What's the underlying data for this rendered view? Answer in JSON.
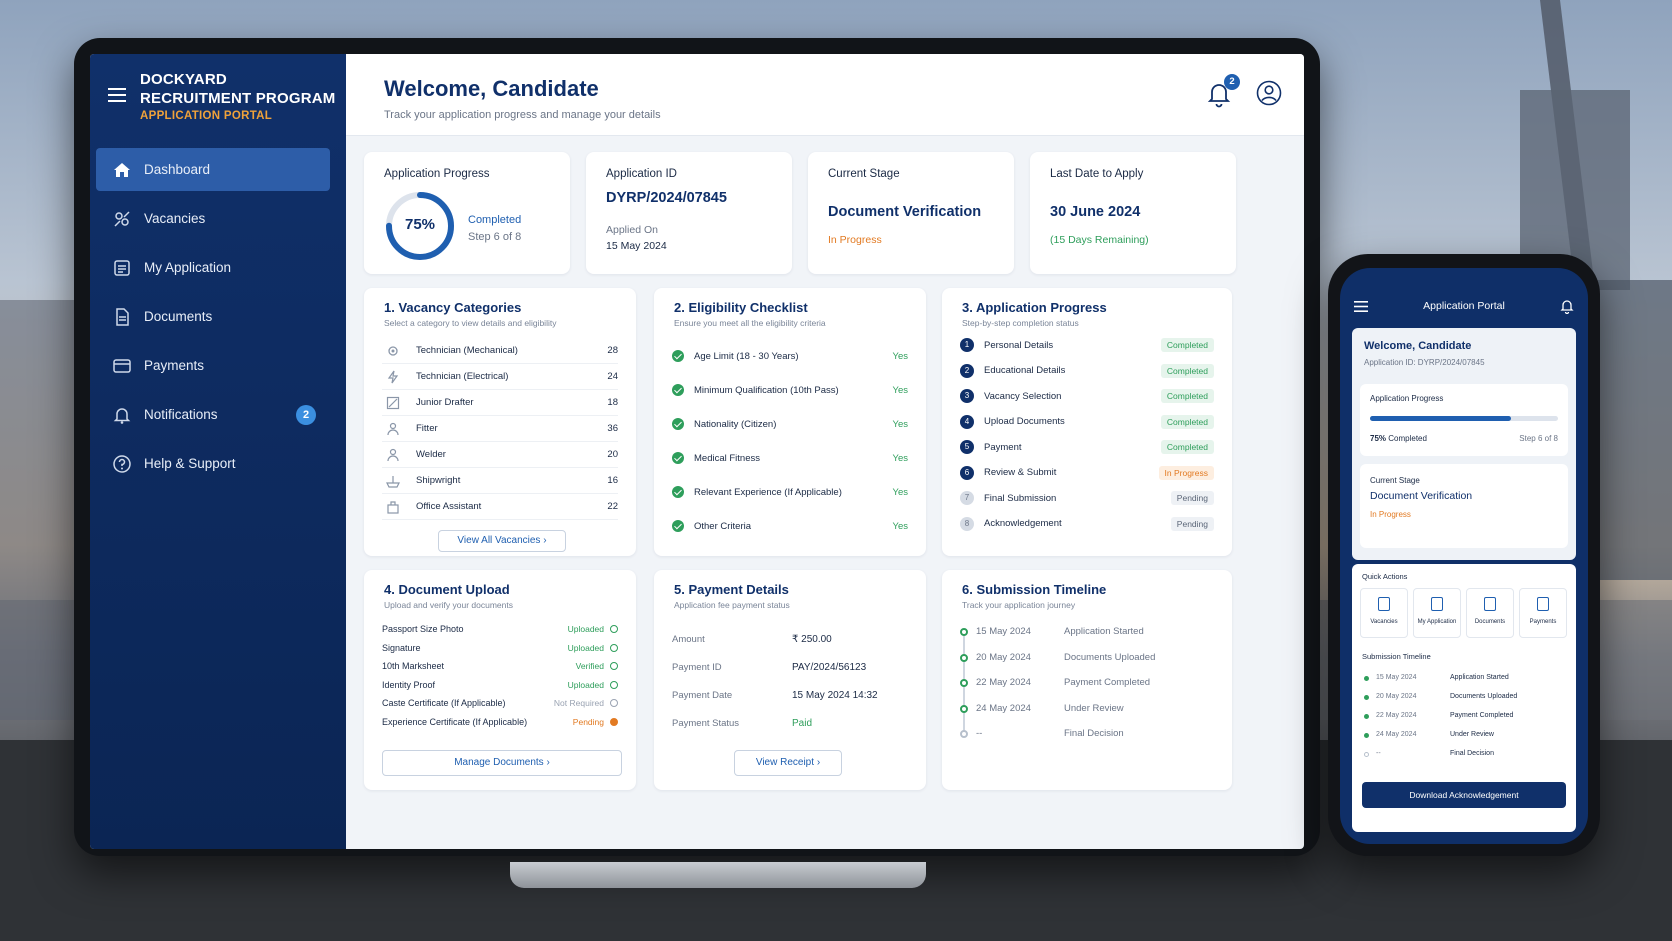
{
  "brand": {
    "line1": "DOCKYARD",
    "line2": "RECRUITMENT PROGRAM",
    "line3": "APPLICATION PORTAL"
  },
  "sidebar": {
    "items": [
      {
        "label": "Dashboard",
        "icon": "home-icon"
      },
      {
        "label": "Vacancies",
        "icon": "vacancies-icon"
      },
      {
        "label": "My Application",
        "icon": "application-icon"
      },
      {
        "label": "Documents",
        "icon": "documents-icon"
      },
      {
        "label": "Payments",
        "icon": "payments-icon"
      },
      {
        "label": "Notifications",
        "icon": "bell-icon",
        "badge": "2"
      },
      {
        "label": "Help & Support",
        "icon": "help-icon"
      }
    ]
  },
  "header": {
    "title": "Welcome, Candidate",
    "subtitle": "Track your application progress and manage your details",
    "notif_count": "2"
  },
  "stats": {
    "progress": {
      "label": "Application Progress",
      "percent_text": "75%",
      "percent": 0.75,
      "status": "Completed",
      "step": "Step 6 of 8"
    },
    "app_id": {
      "label": "Application ID",
      "value": "DYRP/2024/07845",
      "applied_label": "Applied On",
      "applied_date": "15 May 2024"
    },
    "stage": {
      "label": "Current Stage",
      "value": "Document Verification",
      "status": "In Progress"
    },
    "deadline": {
      "label": "Last Date to Apply",
      "value": "30 June 2024",
      "remaining": "(15 Days Remaining)"
    }
  },
  "vacancies": {
    "title": "1. Vacancy Categories",
    "subtitle": "Select a category to view details and eligibility",
    "button": "View All Vacancies",
    "items": [
      {
        "name": "Technician (Mechanical)",
        "count": "28"
      },
      {
        "name": "Technician (Electrical)",
        "count": "24"
      },
      {
        "name": "Junior Drafter",
        "count": "18"
      },
      {
        "name": "Fitter",
        "count": "36"
      },
      {
        "name": "Welder",
        "count": "20"
      },
      {
        "name": "Shipwright",
        "count": "16"
      },
      {
        "name": "Office Assistant",
        "count": "22"
      }
    ]
  },
  "eligibility": {
    "title": "2. Eligibility Checklist",
    "subtitle": "Ensure you meet all the eligibility criteria",
    "items": [
      {
        "name": "Age Limit (18 - 30 Years)",
        "value": "Yes"
      },
      {
        "name": "Minimum Qualification (10th Pass)",
        "value": "Yes"
      },
      {
        "name": "Nationality (Citizen)",
        "value": "Yes"
      },
      {
        "name": "Medical Fitness",
        "value": "Yes"
      },
      {
        "name": "Relevant Experience (If Applicable)",
        "value": "Yes"
      },
      {
        "name": "Other Criteria",
        "value": "Yes"
      }
    ]
  },
  "steps": {
    "title": "3. Application Progress",
    "subtitle": "Step-by-step completion status",
    "items": [
      {
        "num": "1",
        "name": "Personal Details",
        "status": "Completed",
        "kind": "done"
      },
      {
        "num": "2",
        "name": "Educational Details",
        "status": "Completed",
        "kind": "done"
      },
      {
        "num": "3",
        "name": "Vacancy Selection",
        "status": "Completed",
        "kind": "done"
      },
      {
        "num": "4",
        "name": "Upload Documents",
        "status": "Completed",
        "kind": "done"
      },
      {
        "num": "5",
        "name": "Payment",
        "status": "Completed",
        "kind": "done"
      },
      {
        "num": "6",
        "name": "Review & Submit",
        "status": "In Progress",
        "kind": "prog"
      },
      {
        "num": "7",
        "name": "Final Submission",
        "status": "Pending",
        "kind": "pend"
      },
      {
        "num": "8",
        "name": "Acknowledgement",
        "status": "Pending",
        "kind": "pend"
      }
    ]
  },
  "documents": {
    "title": "4. Document Upload",
    "subtitle": "Upload and verify your documents",
    "button": "Manage Documents",
    "items": [
      {
        "name": "Passport Size Photo",
        "status": "Uploaded",
        "color": "#2e9e5b"
      },
      {
        "name": "Signature",
        "status": "Uploaded",
        "color": "#2e9e5b"
      },
      {
        "name": "10th Marksheet",
        "status": "Verified",
        "color": "#2e9e5b"
      },
      {
        "name": "Identity Proof",
        "status": "Uploaded",
        "color": "#2e9e5b"
      },
      {
        "name": "Caste Certificate (If Applicable)",
        "status": "Not Required",
        "color": "#9aa3b2"
      },
      {
        "name": "Experience Certificate (If Applicable)",
        "status": "Pending",
        "color": "#e27a22"
      }
    ]
  },
  "payment": {
    "title": "5. Payment Details",
    "subtitle": "Application fee payment status",
    "button": "View Receipt",
    "rows": [
      {
        "label": "Amount",
        "value": "₹ 250.00"
      },
      {
        "label": "Payment ID",
        "value": "PAY/2024/56123"
      },
      {
        "label": "Payment Date",
        "value": "15 May 2024 14:32"
      },
      {
        "label": "Payment Status",
        "value": "Paid"
      }
    ]
  },
  "timeline": {
    "title": "6. Submission Timeline",
    "subtitle": "Track your application journey",
    "items": [
      {
        "date": "15 May 2024",
        "event": "Application Started",
        "done": true
      },
      {
        "date": "20 May 2024",
        "event": "Documents Uploaded",
        "done": true
      },
      {
        "date": "22 May 2024",
        "event": "Payment Completed",
        "done": true
      },
      {
        "date": "24 May 2024",
        "event": "Under Review",
        "done": true
      },
      {
        "date": "--",
        "event": "Final Decision",
        "done": false
      }
    ]
  },
  "mobile": {
    "title": "Application Portal",
    "welcome": "Welcome, Candidate",
    "app_id": "Application ID: DYRP/2024/07845",
    "progress_label": "Application Progress",
    "progress_pct": "75%",
    "progress_status": "Completed",
    "progress_step": "Step 6 of 8",
    "stage_label": "Current Stage",
    "stage_value": "Document Verification",
    "stage_status": "In Progress",
    "quick_actions": "Quick Actions",
    "actions": [
      "Vacancies",
      "My Application",
      "Documents",
      "Payments"
    ],
    "timeline_label": "Submission Timeline",
    "timeline": [
      {
        "date": "15 May 2024",
        "event": "Application Started"
      },
      {
        "date": "20 May 2024",
        "event": "Documents Uploaded"
      },
      {
        "date": "22 May 2024",
        "event": "Payment Completed"
      },
      {
        "date": "24 May 2024",
        "event": "Under Review"
      },
      {
        "date": "--",
        "event": "Final Decision"
      }
    ],
    "download_button": "Download Acknowledgement"
  },
  "colors": {
    "navy": "#10306a",
    "accent": "#1f5fb0",
    "success": "#2e9e5b",
    "warning": "#e27a22",
    "brand_orange": "#f0a23a"
  }
}
